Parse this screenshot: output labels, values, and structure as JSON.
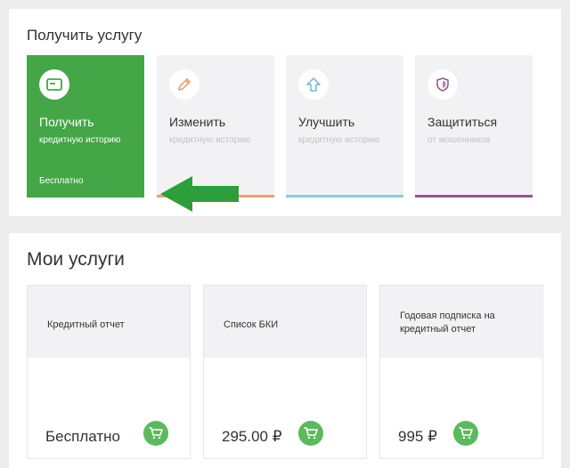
{
  "get_service": {
    "title": "Получить услугу",
    "tiles": [
      {
        "title": "Получить",
        "subtitle": "кредитную историю",
        "price": "Бесплатно",
        "icon": "card-icon",
        "accent": "#44a647"
      },
      {
        "title": "Изменить",
        "subtitle": "кредитную историю",
        "icon": "pencil-icon",
        "accent": "#e8a07a"
      },
      {
        "title": "Улучшить",
        "subtitle": "кредитную историю",
        "icon": "arrow-up-icon",
        "accent": "#8ecbd8"
      },
      {
        "title": "Защититься",
        "subtitle": "от мошенников",
        "icon": "shield-icon",
        "accent": "#8a5a8e"
      }
    ]
  },
  "my_services": {
    "title": "Мои услуги",
    "cards": [
      {
        "title": "Кредитный отчет",
        "price": "Бесплатно"
      },
      {
        "title": "Список БКИ",
        "price": "295.00 ₽"
      },
      {
        "title": "Годовая подписка на кредитный отчет",
        "price": "995 ₽"
      }
    ],
    "cart_icon": "cart-icon"
  },
  "colors": {
    "primary_green": "#44a647",
    "cart_green": "#5bb95e"
  }
}
